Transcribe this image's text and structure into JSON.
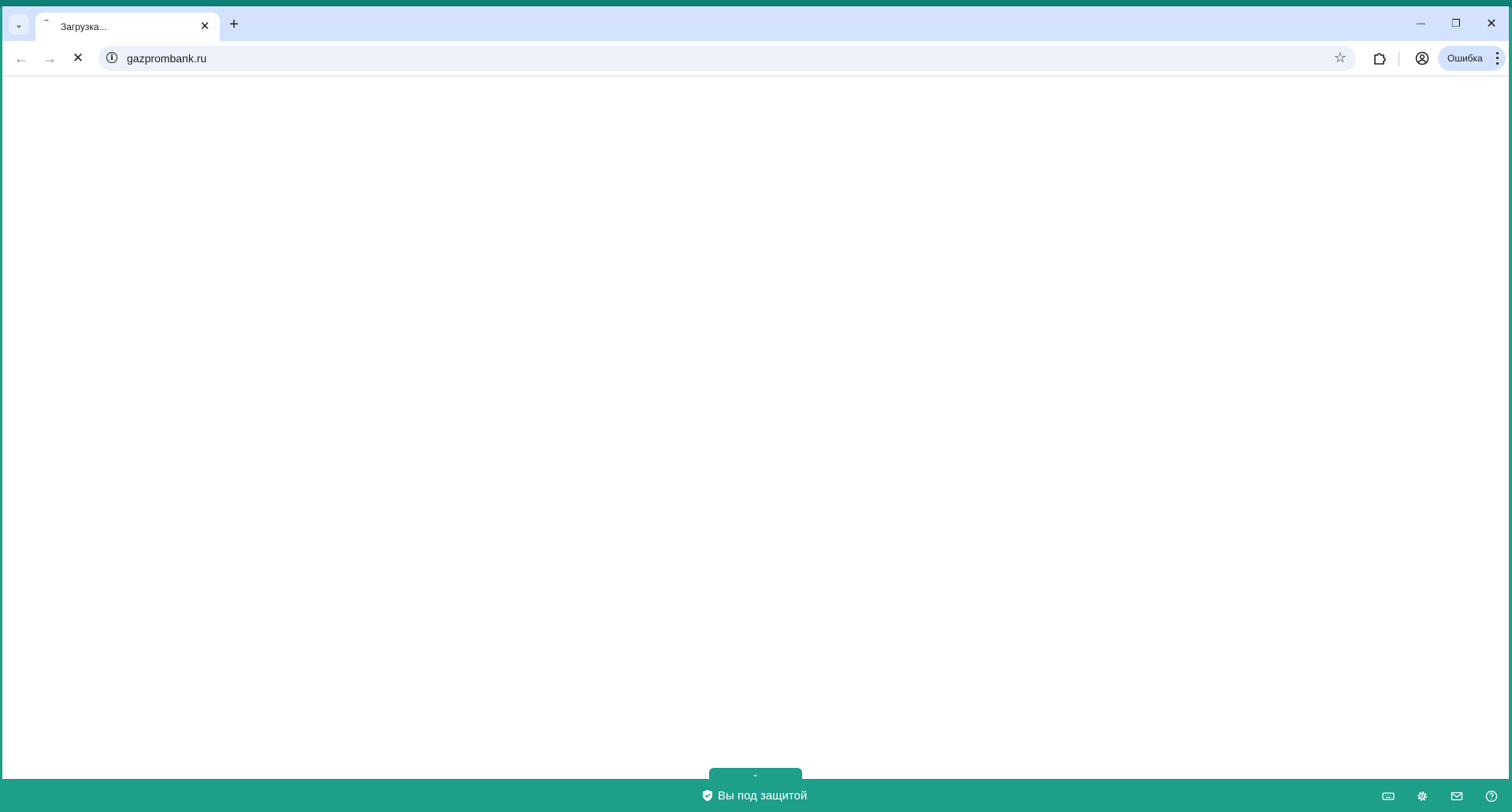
{
  "tabbar": {
    "tab_title": "Загрузка...",
    "tab_close_glyph": "✕",
    "new_tab_glyph": "+",
    "tab_search_glyph": "⌄",
    "minimize_glyph": "—",
    "restore_glyph": "❐",
    "close_glyph": "✕"
  },
  "toolbar": {
    "back_glyph": "←",
    "forward_glyph": "→",
    "stop_glyph": "✕",
    "url": "gazprombank.ru",
    "info_glyph": "i",
    "star_glyph": "☆",
    "profile_status": "Ошибка"
  },
  "statusbar": {
    "collapse_glyph": "⌄",
    "protected_text": "Вы под защитой",
    "icons": [
      "keyboard-icon",
      "gear-icon",
      "mail-icon",
      "help-icon"
    ]
  },
  "colors": {
    "frame": "#1e9f8a",
    "tabbar": "#d3e3fd",
    "omnibox": "#edf2fa"
  }
}
